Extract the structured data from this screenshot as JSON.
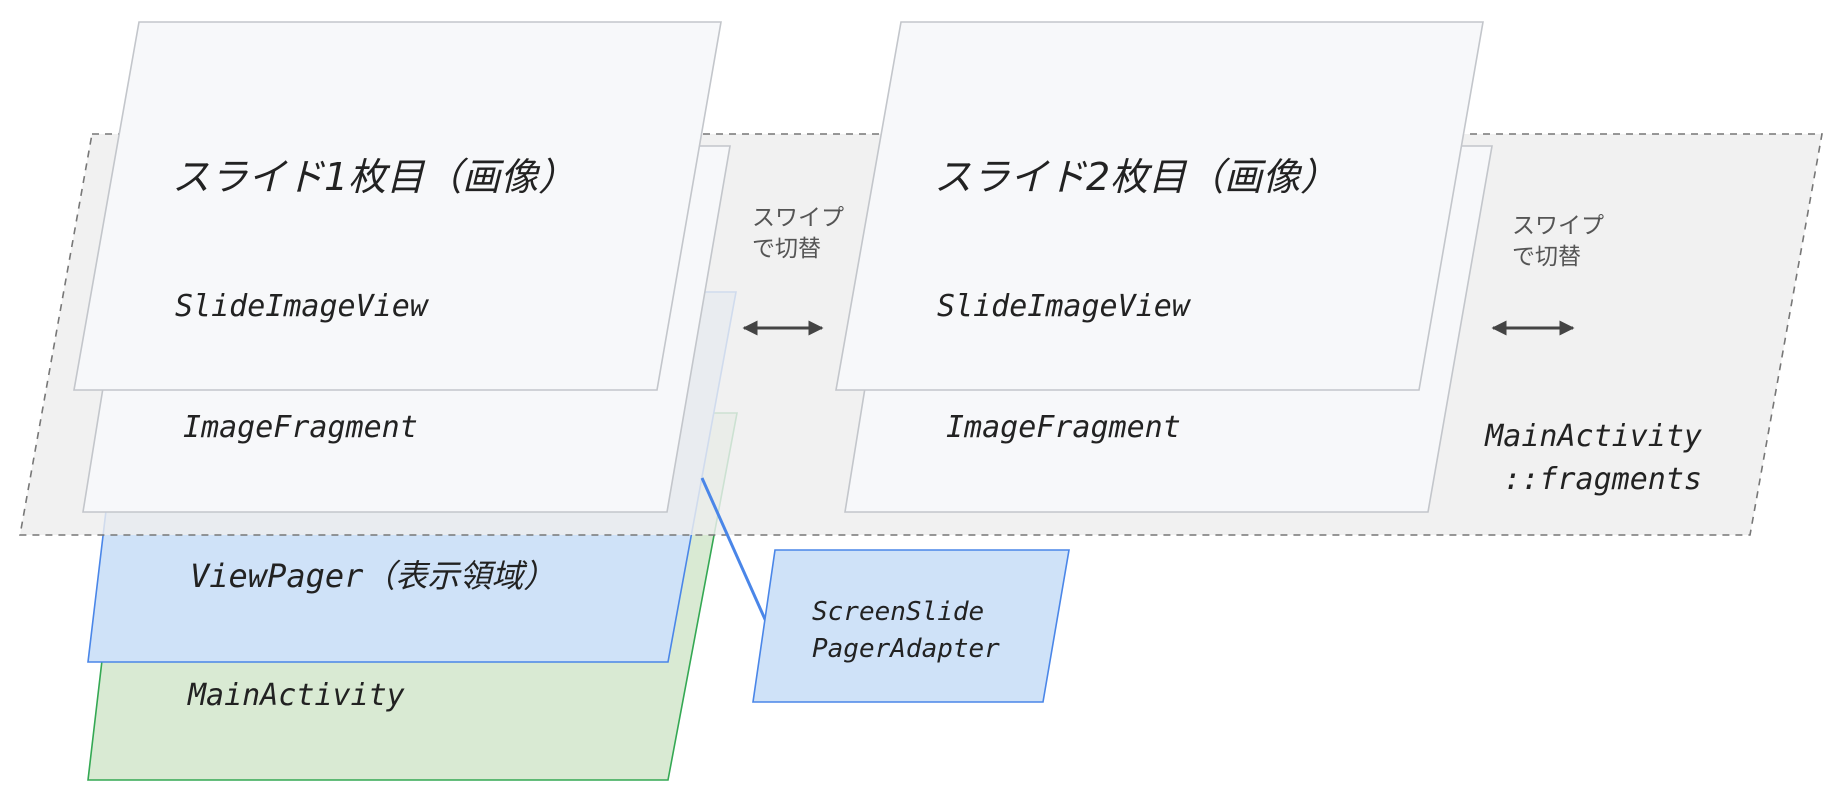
{
  "layers": {
    "main_activity": {
      "label": "MainActivity"
    },
    "view_pager": {
      "label": "ViewPager（表示領域）"
    },
    "fragments_region": {
      "label_line1": "MainActivity",
      "label_line2": "::fragments"
    },
    "adapter": {
      "label_line1": "ScreenSlide",
      "label_line2": "PagerAdapter"
    }
  },
  "slides": [
    {
      "fragment_label": "ImageFragment",
      "view_label": "SlideImageView",
      "title": "スライド1枚目（画像）"
    },
    {
      "fragment_label": "ImageFragment",
      "view_label": "SlideImageView",
      "title": "スライド2枚目（画像）"
    }
  ],
  "swipes": [
    {
      "line1": "スワイプ",
      "line2": "で切替"
    },
    {
      "line1": "スワイプ",
      "line2": "で切替"
    }
  ],
  "colors": {
    "main_activity_fill": "#d9ead3",
    "main_activity_stroke": "#34a853",
    "view_pager_fill": "#cfe2f8",
    "view_pager_stroke": "#4a86e8",
    "fragments_fill": "#f1f1f1",
    "fragments_stroke": "#777777",
    "slide_fill": "#f7f8fa",
    "slide_stroke": "#c3c6cb",
    "arrow": "#444444",
    "text": "#222222",
    "swipe_text": "#555555"
  }
}
